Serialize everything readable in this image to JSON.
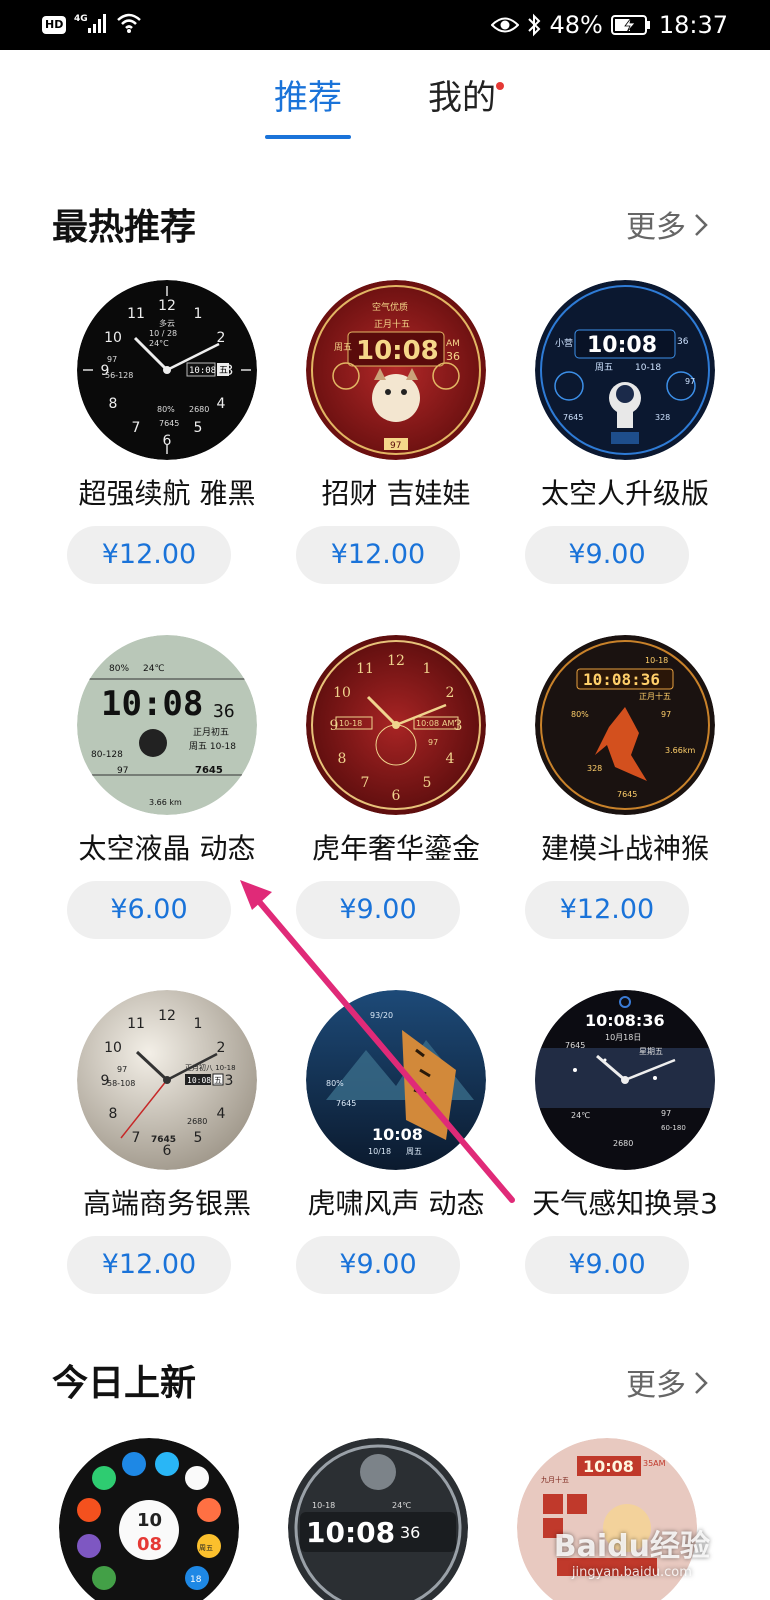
{
  "status_bar": {
    "hd": "HD",
    "network": "4G",
    "battery_percent": "48%",
    "time": "18:37"
  },
  "tabs": [
    {
      "label": "推荐",
      "active": true
    },
    {
      "label": "我的",
      "active": false,
      "has_dot": true
    }
  ],
  "hot": {
    "title": "最热推荐",
    "more": "更多",
    "items": [
      {
        "name": "超强续航 雅黑",
        "price": "¥12.00",
        "face_color": "#0a0a0a"
      },
      {
        "name": "招财 吉娃娃",
        "price": "¥12.00",
        "face_color": "#8e1c1c"
      },
      {
        "name": "太空人升级版",
        "price": "¥9.00",
        "face_color": "#0b1830"
      },
      {
        "name": "太空液晶 动态",
        "price": "¥6.00",
        "face_color": "#b9c7b8"
      },
      {
        "name": "虎年奢华鎏金",
        "price": "¥9.00",
        "face_color": "#7d1616"
      },
      {
        "name": "建模斗战神猴",
        "price": "¥12.00",
        "face_color": "#1a1210"
      },
      {
        "name": "高端商务银黑",
        "price": "¥12.00",
        "face_color": "#c9c3b8"
      },
      {
        "name": "虎啸风声 动态",
        "price": "¥9.00",
        "face_color": "#102640"
      },
      {
        "name": "天气感知换景3",
        "price": "¥9.00",
        "face_color": "#0c0c12"
      }
    ]
  },
  "new": {
    "title": "今日上新",
    "more": "更多"
  },
  "watch_text": {
    "w1_day": "多云",
    "w1_date": "10 / 28",
    "w1_time": "10:08",
    "w1_week": "五",
    "w1_temp": "24°C",
    "w1_hr": "97",
    "w1_hr_range": "56-128",
    "w1_steps": "7645",
    "w1_cal": "2680",
    "w1_pct": "80%",
    "w2_top": "空气优质",
    "w2_time": "10:08",
    "w2_am": "AM",
    "w2_sec": "36",
    "w2_lunar": "正月十五",
    "w2_week": "周五",
    "w2_bottom": "97",
    "w3_time": "10:08",
    "w3_sec": "36",
    "w3_week": "周五",
    "w3_date": "10-18",
    "w3_hr": "97",
    "w3_steps": "7645",
    "w3_cal": "328",
    "w3_city": "小营",
    "w4_time": "10:08",
    "w4_sec": "36",
    "w4_pct": "80%",
    "w4_temp": "24℃",
    "w4_lunar": "正月初五",
    "w4_week": "周五 10-18",
    "w4_range": "80-128",
    "w4_hr": "97",
    "w4_steps": "7645",
    "w4_dist": "3.66 km",
    "w5_date": "10-18",
    "w5_time": "10:08",
    "w5_am": "AM",
    "w5_hr": "97",
    "w6_time": "10:08:36",
    "w6_date": "10-18",
    "w6_lunar": "正月十五",
    "w6_pct": "80%",
    "w6_hr": "97",
    "w6_steps": "7645",
    "w6_cal": "328",
    "w6_dist": "3.66km",
    "w7_date": "正月初八 10-18",
    "w7_time": "10:08",
    "w7_week": "五",
    "w7_hr": "97",
    "w7_range": "58-108",
    "w7_steps": "7645",
    "w7_cal": "2680",
    "w8_date": "93/20",
    "w8_time": "10:08",
    "w8_day": "10/18",
    "w8_week": "周五",
    "w8_pct": "80%",
    "w8_steps": "7645",
    "w9_time": "10:08:36",
    "w9_date": "10月18日",
    "w9_week": "星期五",
    "w9_steps": "7645",
    "w9_hr": "97",
    "w9_temp": "24℃",
    "w9_cal": "2680",
    "w9_range": "60-180",
    "n1_time": "10",
    "n1_min": "08",
    "n1_week": "周五",
    "n1_day": "18",
    "n2_time": "10:08",
    "n2_sec": "36",
    "n2_date": "10-18",
    "n2_temp": "24℃",
    "n3_time": "10:08",
    "n3_lunar": "九月十五",
    "n3_sec": "35AM"
  },
  "watermark": {
    "brand": "Baidu经验",
    "url": "jingyan.baidu.com"
  },
  "colors": {
    "accent": "#1a73d9",
    "annotation_arrow": "#e02a78",
    "badge_dot": "#e53935"
  }
}
